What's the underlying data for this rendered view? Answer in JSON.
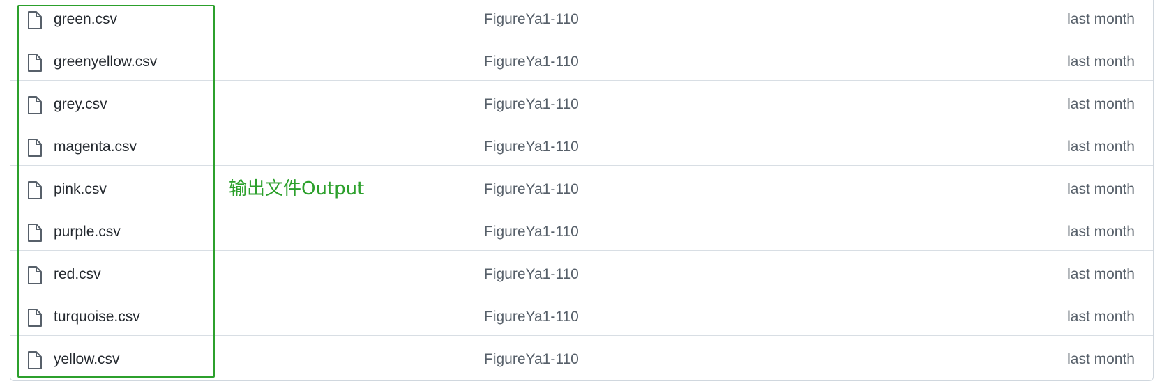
{
  "files": [
    {
      "name": "green.csv",
      "commit": "FigureYa1-110",
      "date": "last month",
      "icon": "file-icon"
    },
    {
      "name": "greenyellow.csv",
      "commit": "FigureYa1-110",
      "date": "last month",
      "icon": "file-icon"
    },
    {
      "name": "grey.csv",
      "commit": "FigureYa1-110",
      "date": "last month",
      "icon": "file-icon"
    },
    {
      "name": "magenta.csv",
      "commit": "FigureYa1-110",
      "date": "last month",
      "icon": "file-icon"
    },
    {
      "name": "pink.csv",
      "commit": "FigureYa1-110",
      "date": "last month",
      "icon": "file-icon"
    },
    {
      "name": "purple.csv",
      "commit": "FigureYa1-110",
      "date": "last month",
      "icon": "file-icon"
    },
    {
      "name": "red.csv",
      "commit": "FigureYa1-110",
      "date": "last month",
      "icon": "file-icon"
    },
    {
      "name": "turquoise.csv",
      "commit": "FigureYa1-110",
      "date": "last month",
      "icon": "file-icon"
    },
    {
      "name": "yellow.csv",
      "commit": "FigureYa1-110",
      "date": "last month",
      "icon": "file-icon"
    }
  ],
  "annotation": {
    "text": "输出文件Output",
    "color": "#2ca02c"
  },
  "colors": {
    "annotation_green": "#2ca02c",
    "border": "#d0d7de",
    "text": "#24292f",
    "muted": "#57606a"
  }
}
